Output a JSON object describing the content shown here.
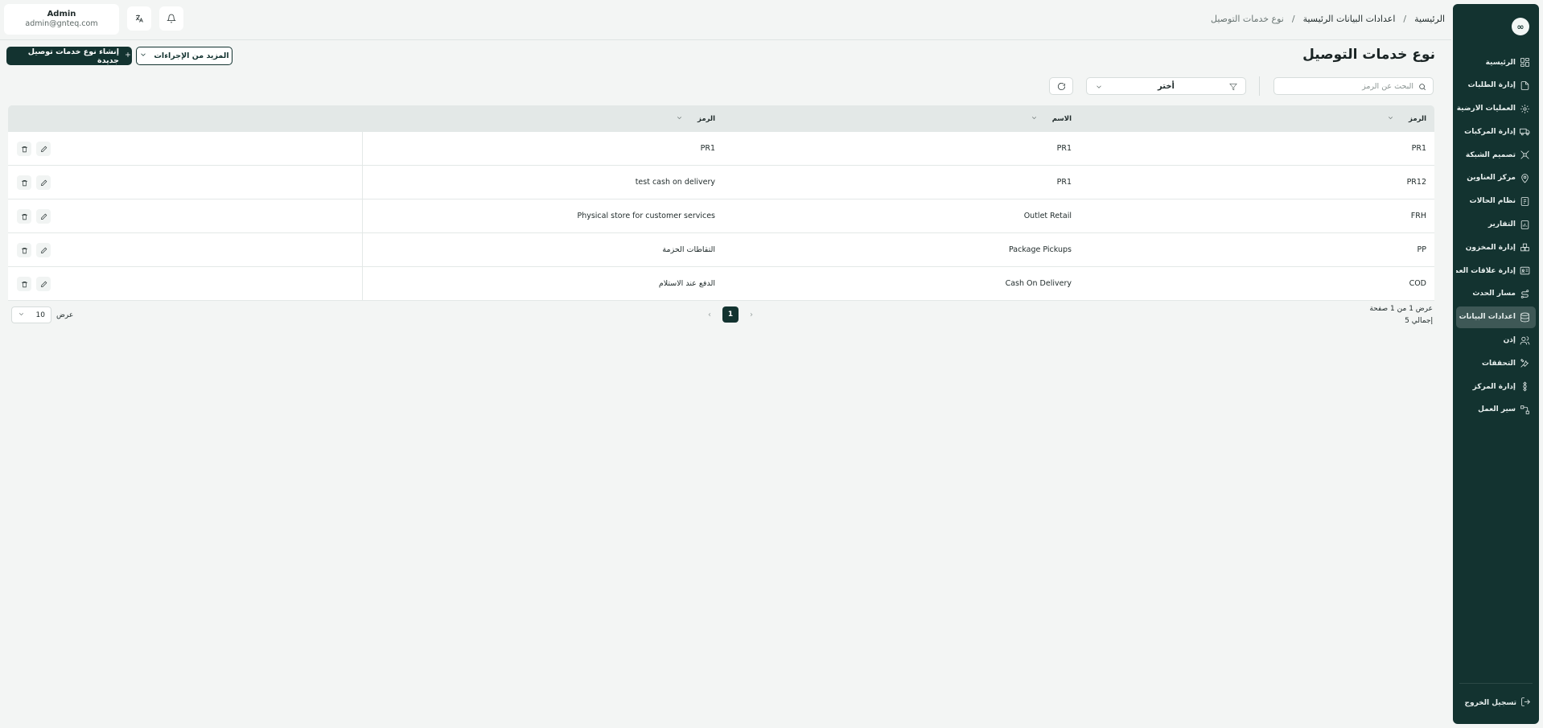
{
  "sidebar": {
    "logo": "∞",
    "items": [
      {
        "label": "الرئيسية",
        "icon": "dashboard-icon",
        "active": false
      },
      {
        "label": "إدارة الطلبات",
        "icon": "orders-icon",
        "active": false
      },
      {
        "label": "العمليات الارضية",
        "icon": "ground-ops-icon",
        "active": false
      },
      {
        "label": "إدارة المركبات",
        "icon": "truck-icon",
        "active": false
      },
      {
        "label": "تصميم الشبكة",
        "icon": "network-icon",
        "active": false
      },
      {
        "label": "مركز العناوين",
        "icon": "location-icon",
        "active": false
      },
      {
        "label": "نظام الحالات",
        "icon": "status-icon",
        "active": false
      },
      {
        "label": "التقارير",
        "icon": "reports-icon",
        "active": false
      },
      {
        "label": "إدارة المخزون",
        "icon": "inventory-icon",
        "active": false
      },
      {
        "label": "إدارة علاقات العملاء",
        "icon": "crm-icon",
        "active": false
      },
      {
        "label": "مسار الحدث",
        "icon": "route-icon",
        "active": false
      },
      {
        "label": "اعدادات البيانات",
        "icon": "database-icon",
        "active": true
      },
      {
        "label": "إذن",
        "icon": "users-icon",
        "active": false
      },
      {
        "label": "التحققات",
        "icon": "tools-icon",
        "active": false
      },
      {
        "label": "إدارة المركز",
        "icon": "hub-icon",
        "active": false
      },
      {
        "label": "سير العمل",
        "icon": "workflow-icon",
        "active": false
      }
    ],
    "logout_label": "تسجيل الخروج"
  },
  "breadcrumb": {
    "home": "الرئيسية",
    "parent": "اعدادات البيانات الرئيسية",
    "current": "نوع خدمات التوصيل",
    "separator": "/"
  },
  "user": {
    "name": "Admin",
    "email": "admin@gnteq.com"
  },
  "page": {
    "title": "نوع خدمات التوصيل",
    "create_label": "إنشاء نوع خدمات توصيل جديدة",
    "more_actions_label": "المزيد من الإجراءات"
  },
  "filters": {
    "search_placeholder": "البحث عن الرمز",
    "select_value": "أختر"
  },
  "table": {
    "headers": [
      "الرمز",
      "الاسم",
      "الرمز"
    ],
    "rows": [
      [
        "PR1",
        "PR1",
        "PR1"
      ],
      [
        "PR12",
        "PR1",
        "test cash on delivery"
      ],
      [
        "FRH",
        "Outlet Retail",
        "Physical store for customer services"
      ],
      [
        "PP",
        "Package Pickups",
        "التقاطات الحزمة"
      ],
      [
        "COD",
        "Cash On Delivery",
        "الدفع عند الاستلام"
      ]
    ]
  },
  "footer": {
    "showing": "عرض 1 من 1 صفحة",
    "total": "إجمالي 5",
    "page": "1",
    "page_size": "10",
    "page_size_label": "عرض"
  }
}
